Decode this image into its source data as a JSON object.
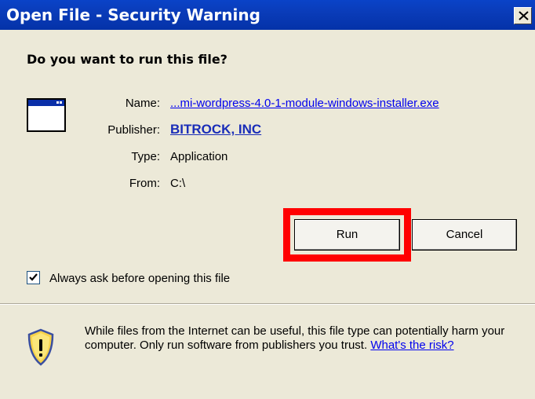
{
  "window": {
    "title": "Open File - Security Warning",
    "close_glyph": "×"
  },
  "dialog": {
    "question": "Do you want to run this file?",
    "icon": "application-window-icon",
    "fields": {
      "name_label": "Name:",
      "name_value": "...mi-wordpress-4.0-1-module-windows-installer.exe",
      "publisher_label": "Publisher:",
      "publisher_value": "BITROCK, INC",
      "type_label": "Type:",
      "type_value": "Application",
      "from_label": "From:",
      "from_value": "C:\\"
    },
    "buttons": {
      "run": "Run",
      "cancel": "Cancel"
    },
    "checkbox": {
      "label": "Always ask before opening this file",
      "checked": true
    },
    "warning": {
      "text": "While files from the Internet can be useful, this file type can potentially harm your computer. Only run software from publishers you trust.",
      "risk_link": "What's the risk?",
      "icon": "shield-warning-icon"
    }
  },
  "colors": {
    "titlebar": "#0a3cb9",
    "dialog_bg": "#ece9d8",
    "highlight": "#ff0000",
    "link": "#0000ee"
  }
}
